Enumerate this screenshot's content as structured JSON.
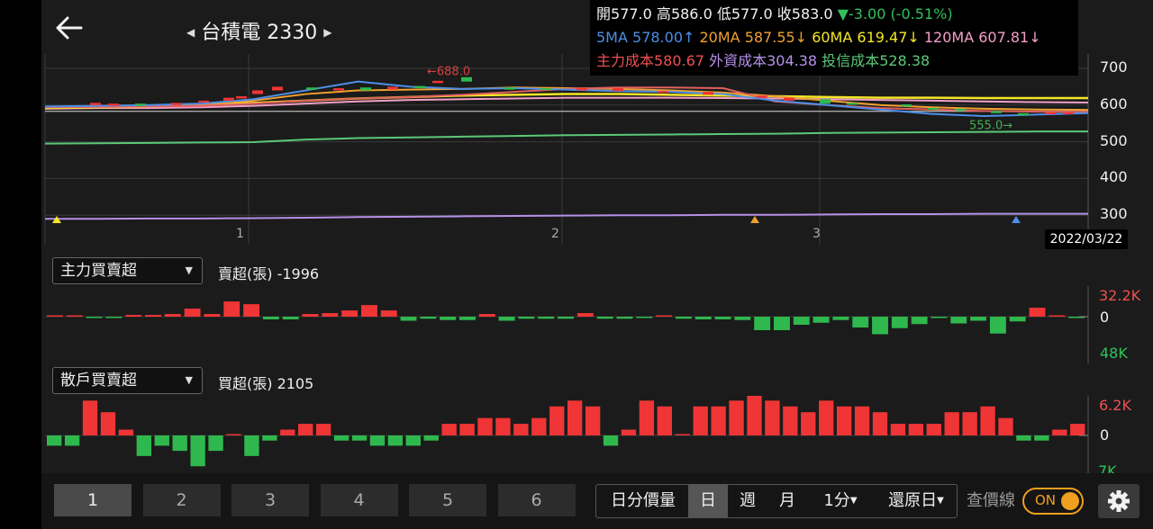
{
  "header": {
    "stock_name": "台積電",
    "stock_code": "2330"
  },
  "info": {
    "open_label": "開",
    "open": "577.0",
    "high_label": "高",
    "high": "586.0",
    "low_label": "低",
    "low": "577.0",
    "close_label": "收",
    "close": "583.0",
    "change": "▼-3.00 (-0.51%)",
    "ma5": "5MA 578.00↑",
    "ma20": "20MA 587.55↓",
    "ma60": "60MA 619.47↓",
    "ma120": "120MA 607.81↓",
    "main_cost": "主力成本580.67",
    "foreign_cost": "外資成本304.38",
    "trust_cost": "投信成本528.38"
  },
  "price_chart": {
    "y_ticks": [
      "700",
      "600",
      "500",
      "400",
      "300"
    ],
    "x_ticks": [
      "1",
      "2",
      "3"
    ],
    "high_annotation": "688.0",
    "low_annotation": "555.0",
    "date": "2022/03/22"
  },
  "panel1": {
    "selector": "主力買賣超",
    "summary": "賣超(張) -1996",
    "top_label": "32.2K",
    "zero_label": "0",
    "bottom_label": "48K"
  },
  "panel2": {
    "selector": "散戶買賣超",
    "summary": "買超(張) 2105",
    "top_label": "6.2K",
    "zero_label": "0",
    "bottom_label": "7K"
  },
  "bottom": {
    "pages": [
      "1",
      "2",
      "3",
      "4",
      "5",
      "6"
    ],
    "active_page": "1",
    "tf_volume": "日分價量",
    "tf_day": "日",
    "tf_week": "週",
    "tf_month": "月",
    "tf_minute": "1分",
    "tf_restore": "還原日",
    "price_line_label": "查價線",
    "toggle_label": "ON"
  },
  "colors": {
    "up": "#ef3535",
    "down": "#2fb84d",
    "ma5": "#4d8ee8",
    "ma20": "#f0a030",
    "ma60": "#f5e628",
    "ma120": "#f2a0c8",
    "main_cost": "#ef5050",
    "foreign_cost": "#b590e8",
    "trust_cost": "#5cc878"
  },
  "chart_data": [
    {
      "type": "bar",
      "title": "主力買賣超",
      "ylim": [
        -48,
        32.2
      ],
      "values": [
        1,
        1,
        -2,
        -2,
        2,
        2,
        3,
        9,
        3,
        17,
        14,
        -4,
        -4,
        3,
        4,
        7,
        13,
        7,
        -6,
        -3,
        -5,
        -5,
        3,
        -6,
        -3,
        -3,
        -3,
        4,
        -3,
        -3,
        -1,
        1,
        -3,
        -4,
        -4,
        -5,
        -20,
        -20,
        -12,
        -9,
        -5,
        -16,
        -26,
        -17,
        -11,
        -2,
        -10,
        -6,
        -25,
        -7,
        10,
        1,
        -1
      ],
      "unit": "K張"
    },
    {
      "type": "bar",
      "title": "散戶買賣超",
      "ylim": [
        -7,
        6.2
      ],
      "values": [
        -2,
        -2,
        6,
        4,
        1,
        -4,
        -2,
        -3,
        -6,
        -3,
        0,
        -4,
        -1,
        1,
        2,
        2,
        -1,
        -1,
        -2,
        -2,
        -2,
        -1,
        2,
        2,
        3,
        3,
        2,
        3,
        5,
        6,
        5,
        -2,
        1,
        6,
        5,
        0,
        5,
        5,
        6,
        7,
        6,
        5,
        4,
        6,
        5,
        5,
        4,
        2,
        2,
        2,
        4,
        4,
        5,
        3,
        -1,
        -1,
        1,
        2
      ],
      "unit": "K張"
    }
  ]
}
